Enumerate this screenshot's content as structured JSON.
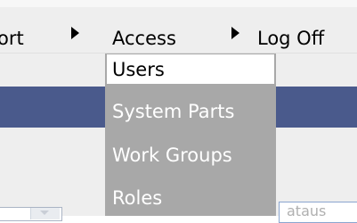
{
  "menubar": {
    "items": [
      {
        "label": "ort"
      },
      {
        "label": "Access"
      },
      {
        "label": "Log Off"
      }
    ]
  },
  "access_menu": {
    "items": [
      {
        "label": "Users",
        "active": true
      },
      {
        "label": "System Parts"
      },
      {
        "label": "Work Groups"
      },
      {
        "label": "Roles"
      }
    ]
  },
  "status_field": {
    "value": "ataus"
  },
  "colors": {
    "menubar_bg": "#eeeeee",
    "dropdown_bg": "#a8a8a8",
    "header_band": "#4a5a8c",
    "active_item_bg": "#ffffff"
  }
}
